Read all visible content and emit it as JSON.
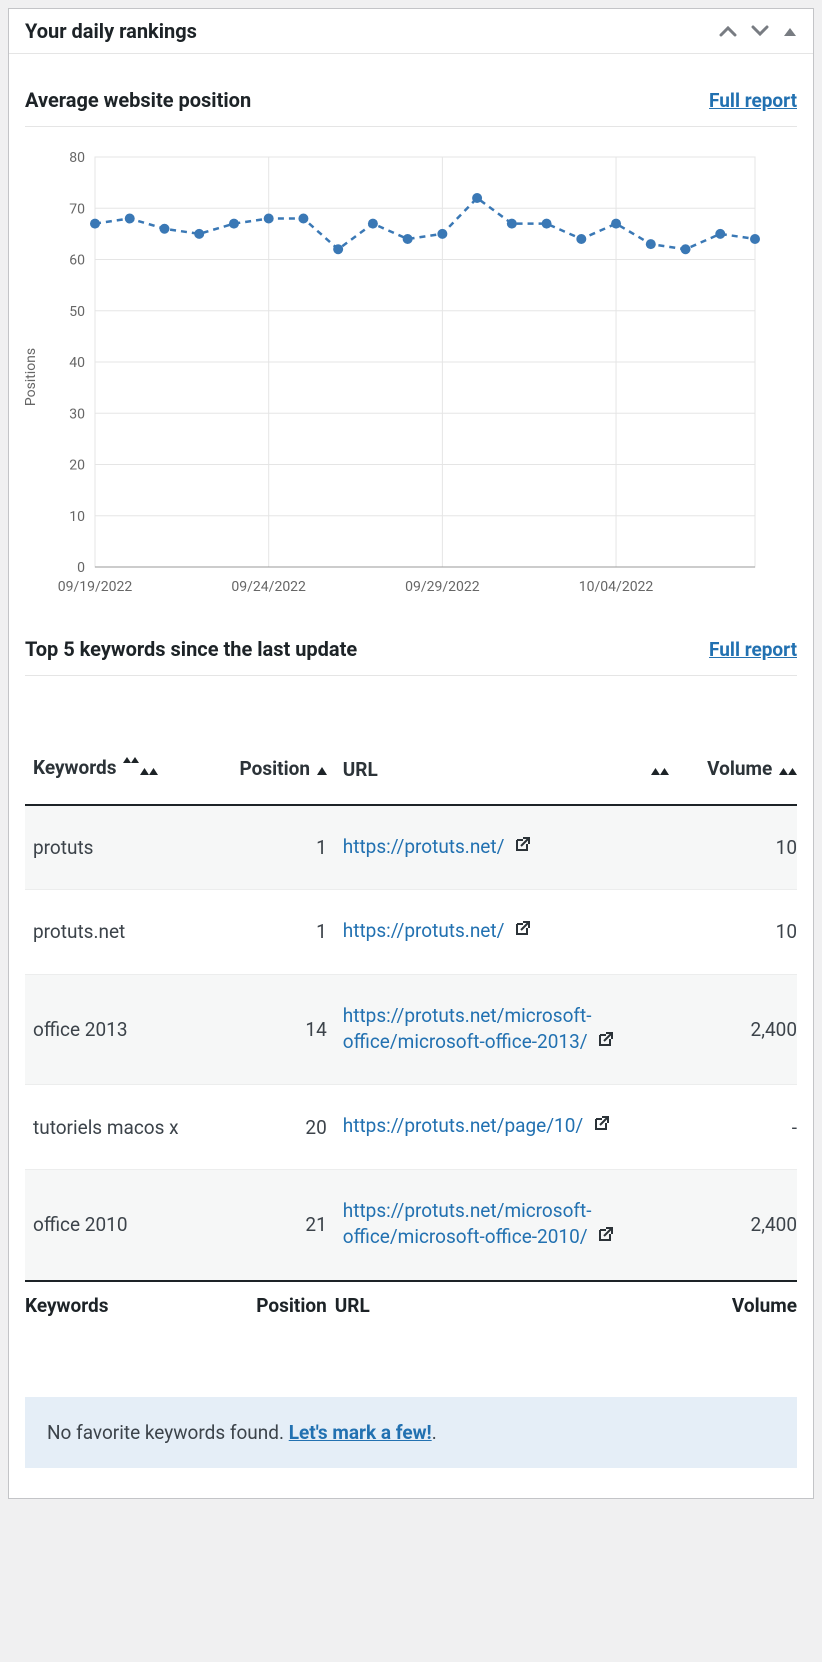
{
  "panel": {
    "title": "Your daily rankings"
  },
  "sections": {
    "avg": {
      "title": "Average website position",
      "full_report": "Full report"
    },
    "top5": {
      "title": "Top 5 keywords since the last update",
      "full_report": "Full report"
    }
  },
  "table": {
    "headers": {
      "keywords": "Keywords",
      "position": "Position",
      "url": "URL",
      "volume": "Volume"
    },
    "footer": {
      "keywords": "Keywords",
      "position": "Position",
      "url": "URL",
      "volume": "Volume"
    },
    "rows": [
      {
        "keyword": "protuts",
        "position": "1",
        "url": "https://protuts.net/",
        "volume": "10"
      },
      {
        "keyword": "protuts.net",
        "position": "1",
        "url": "https://protuts.net/",
        "volume": "10"
      },
      {
        "keyword": "office 2013",
        "position": "14",
        "url": "https://protuts.net/microsoft-office/microsoft-office-2013/",
        "volume": "2,400"
      },
      {
        "keyword": "tutoriels macos x",
        "position": "20",
        "url": "https://protuts.net/page/10/",
        "volume": "-"
      },
      {
        "keyword": "office 2010",
        "position": "21",
        "url": "https://protuts.net/microsoft-office/microsoft-office-2010/",
        "volume": "2,400"
      }
    ]
  },
  "notice": {
    "text": "No favorite keywords found. ",
    "link": "Let's mark a few!"
  },
  "chart_data": {
    "type": "line",
    "title": "",
    "xlabel": "",
    "ylabel": "Positions",
    "ylim": [
      0,
      80
    ],
    "yticks": [
      0,
      10,
      20,
      30,
      40,
      50,
      60,
      70,
      80
    ],
    "xtick_labels": [
      "09/19/2022",
      "09/24/2022",
      "09/29/2022",
      "10/04/2022"
    ],
    "xtick_idx": [
      0,
      5,
      10,
      15
    ],
    "categories": [
      "09/19/2022",
      "09/20/2022",
      "09/21/2022",
      "09/22/2022",
      "09/23/2022",
      "09/24/2022",
      "09/25/2022",
      "09/26/2022",
      "09/27/2022",
      "09/28/2022",
      "09/29/2022",
      "09/30/2022",
      "10/01/2022",
      "10/02/2022",
      "10/03/2022",
      "10/04/2022",
      "10/05/2022",
      "10/06/2022",
      "10/07/2022",
      "10/08/2022"
    ],
    "values": [
      67,
      68,
      66,
      65,
      67,
      68,
      68,
      62,
      67,
      64,
      65,
      72,
      67,
      67,
      64,
      67,
      63,
      62,
      65,
      64
    ]
  }
}
